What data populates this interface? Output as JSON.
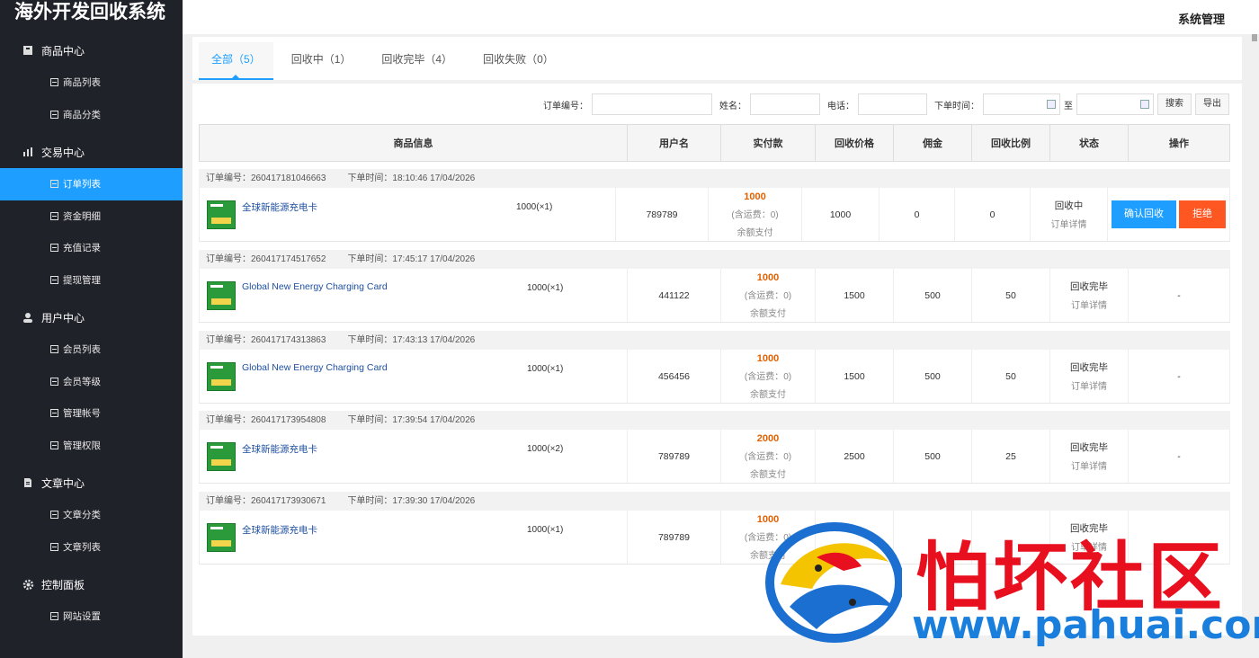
{
  "app": {
    "title": "海外开发回收系统",
    "header_right": "系统管理"
  },
  "sidebar": {
    "groups": [
      {
        "label": "商品中心",
        "icon": "box-icon",
        "items": [
          "商品列表",
          "商品分类"
        ]
      },
      {
        "label": "交易中心",
        "icon": "bar-chart-icon",
        "items": [
          "订单列表",
          "资金明细",
          "充值记录",
          "提现管理"
        ]
      },
      {
        "label": "用户中心",
        "icon": "user-icon",
        "items": [
          "会员列表",
          "会员等级",
          "管理帐号",
          "管理权限"
        ]
      },
      {
        "label": "文章中心",
        "icon": "document-icon",
        "items": [
          "文章分类",
          "文章列表"
        ]
      },
      {
        "label": "控制面板",
        "icon": "gear-icon",
        "items": [
          "网站设置"
        ]
      }
    ],
    "active_item": "订单列表"
  },
  "tabs": [
    "全部（5）",
    "回收中（1）",
    "回收完毕（4）",
    "回收失败（0）"
  ],
  "filters": {
    "order_no_label": "订单编号：",
    "name_label": "姓名：",
    "phone_label": "电话：",
    "time_label": "下单时间：",
    "to_label": "至",
    "search_btn": "搜索",
    "export_btn": "导出"
  },
  "columns": [
    "商品信息",
    "用户名",
    "实付款",
    "回收价格",
    "佣金",
    "回收比例",
    "状态",
    "操作"
  ],
  "orders": [
    {
      "order_no": "订单编号：260417181046663",
      "time": "下单时间：18:10:46 17/04/2026",
      "product": "全球新能源充电卡",
      "qty": "1000(×1)",
      "user": "789789",
      "paid": "1000",
      "shipping": "(含运费：0)",
      "paytype": "余额支付",
      "price": "1000",
      "commission": "0",
      "ratio": "0",
      "status": "回收中",
      "detail": "订单详情",
      "confirm": "确认回收",
      "reject": "拒绝",
      "op": ""
    },
    {
      "order_no": "订单编号：260417174517652",
      "time": "下单时间：17:45:17 17/04/2026",
      "product": "Global New Energy Charging Card",
      "qty": "1000(×1)",
      "user": "441122",
      "paid": "1000",
      "shipping": "(含运费：0)",
      "paytype": "余额支付",
      "price": "1500",
      "commission": "500",
      "ratio": "50",
      "status": "回收完毕",
      "detail": "订单详情",
      "op": "-"
    },
    {
      "order_no": "订单编号：260417174313863",
      "time": "下单时间：17:43:13 17/04/2026",
      "product": "Global New Energy Charging Card",
      "qty": "1000(×1)",
      "user": "456456",
      "paid": "1000",
      "shipping": "(含运费：0)",
      "paytype": "余额支付",
      "price": "1500",
      "commission": "500",
      "ratio": "50",
      "status": "回收完毕",
      "detail": "订单详情",
      "op": "-"
    },
    {
      "order_no": "订单编号：260417173954808",
      "time": "下单时间：17:39:54 17/04/2026",
      "product": "全球新能源充电卡",
      "qty": "1000(×2)",
      "user": "789789",
      "paid": "2000",
      "shipping": "(含运费：0)",
      "paytype": "余额支付",
      "price": "2500",
      "commission": "500",
      "ratio": "25",
      "status": "回收完毕",
      "detail": "订单详情",
      "op": "-"
    },
    {
      "order_no": "订单编号：260417173930671",
      "time": "下单时间：17:39:30 17/04/2026",
      "product": "全球新能源充电卡",
      "qty": "1000(×1)",
      "user": "789789",
      "paid": "1000",
      "shipping": "(含运费：0)",
      "paytype": "余额支付",
      "price": "",
      "commission": "",
      "ratio": "",
      "status": "回收完毕",
      "detail": "订单详情",
      "op": ""
    }
  ],
  "watermark": {
    "text": "怕坏社区",
    "url": "www.pahuai.com"
  }
}
